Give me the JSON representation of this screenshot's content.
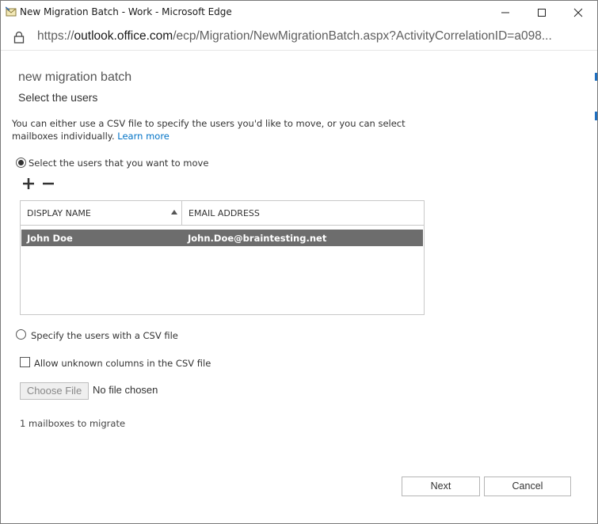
{
  "window": {
    "title": "New Migration Batch - Work - Microsoft Edge",
    "url_prefix": "https://",
    "url_host": "outlook.office.com",
    "url_path": "/ecp/Migration/NewMigrationBatch.aspx?ActivityCorrelationID=a098..."
  },
  "wizard": {
    "heading": "new migration batch",
    "subheading": "Select the users",
    "description": "You can either use a CSV file to specify the users you'd like to move, or you can select mailboxes individually.",
    "learn_more": "Learn more",
    "option_select_users": "Select the users that you want to move",
    "option_csv": "Specify the users with a CSV file",
    "allow_unknown_columns": "Allow unknown columns in the CSV file",
    "choose_file": "Choose File",
    "no_file": "No file chosen",
    "mailbox_count": "1 mailboxes to migrate"
  },
  "table": {
    "columns": [
      "DISPLAY NAME",
      "EMAIL ADDRESS"
    ],
    "rows": [
      {
        "display_name": "John Doe",
        "email": "John.Doe@braintesting.net"
      }
    ]
  },
  "footer": {
    "next": "Next",
    "cancel": "Cancel"
  },
  "colors": {
    "accent": "#0072c6",
    "selected_row": "#6d6d6d",
    "side_strip": "#1f70c1"
  }
}
